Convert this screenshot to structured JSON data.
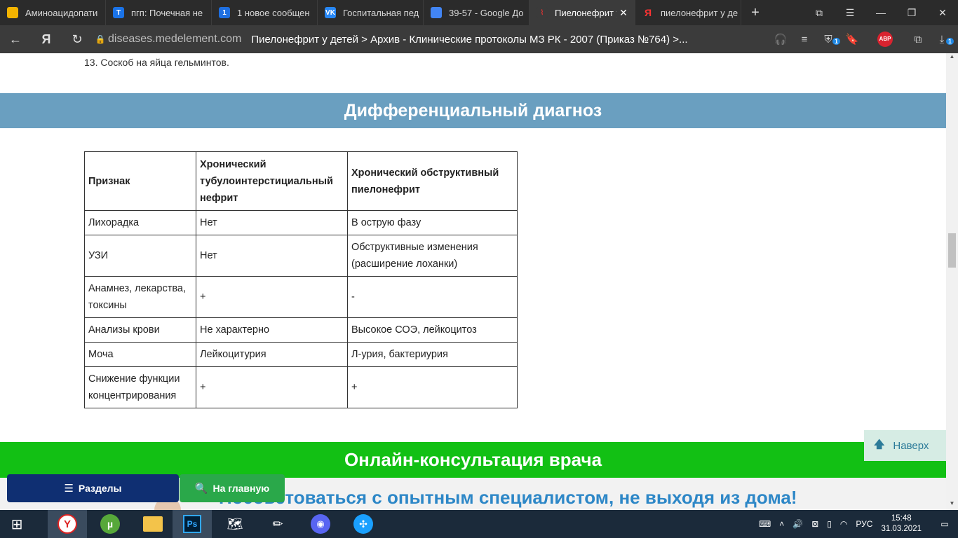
{
  "tabs": [
    {
      "title": "Аминоацидопати",
      "icon": "slides-icon",
      "color": "#f4b400",
      "glyph": "",
      "active": false
    },
    {
      "title": "пгп: Почечная не",
      "icon": "search-circle-icon",
      "color": "#1a73e8",
      "glyph": "T",
      "active": false
    },
    {
      "title": "1 новое сообщен",
      "icon": "message-badge-icon",
      "color": "#1e6fe0",
      "glyph": "1",
      "active": false
    },
    {
      "title": "Госпитальная пед",
      "icon": "vk-icon",
      "color": "#2787f5",
      "glyph": "VK",
      "active": false
    },
    {
      "title": "39-57 - Google До",
      "icon": "docs-icon",
      "color": "#4285f4",
      "glyph": "",
      "active": false
    },
    {
      "title": "Пиелонефрит у",
      "icon": "medelement-icon",
      "color": "#3b3b3b",
      "glyph": "",
      "active": true
    },
    {
      "title": "пиелонефрит у де",
      "icon": "yandex-icon",
      "color": "#2b2b2b",
      "glyph": "Я",
      "active": false
    }
  ],
  "addressbar": {
    "domain": "diseases.medelement.com",
    "title": "Пиелонефрит у детей > Архив - Клинические протоколы МЗ РК - 2007 (Приказ №764) >...",
    "abp_label": "ABP",
    "shield_badge": "1",
    "download_badge": "1"
  },
  "content": {
    "prev_line": "13. Соскоб на яйца гельминтов.",
    "section_title": "Дифференциальный диагноз",
    "table": {
      "headers": [
        "Признак",
        "Хронический тубулоинтерстициальный нефрит",
        "Хронический обструктивный пиелонефрит"
      ],
      "rows": [
        [
          "Лихорадка",
          "Нет",
          "В острую фазу"
        ],
        [
          "УЗИ",
          "Нет",
          "Обструктивные изменения (расширение лоханки)"
        ],
        [
          "Анамнез, лекарства, токсины",
          "+",
          "-"
        ],
        [
          "Анализы крови",
          "Не характерно",
          "Высокое СОЭ, лейкоцитоз"
        ],
        [
          "Моча",
          "Лейкоцитурия",
          "Л-урия, бактериурия"
        ],
        [
          "Снижение функции концентрирования",
          "+",
          "+"
        ]
      ]
    },
    "consult_title": "Онлайн-консультация врача",
    "consult_subtitle": "Посоветоваться с опытным специалистом, не выходя из дома!",
    "back_to_top": "Наверх",
    "sections_button": "Разделы",
    "home_button": "На главную"
  },
  "taskbar": {
    "language": "РУС",
    "time": "15:48",
    "date": "31.03.2021"
  }
}
